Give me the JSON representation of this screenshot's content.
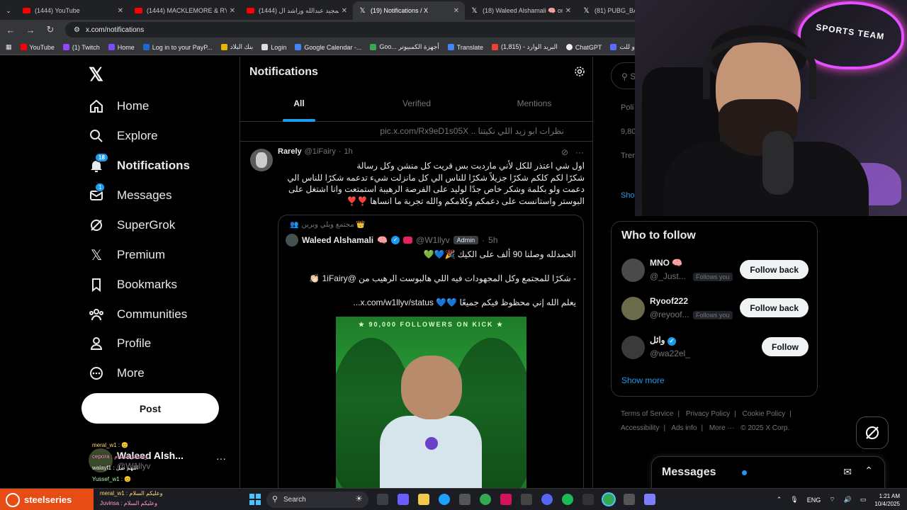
{
  "browser": {
    "tabs": [
      {
        "title": "(1444) YouTube",
        "icon": "youtube-icon",
        "active": false
      },
      {
        "title": "(1444) MACKLEMORE & RY",
        "icon": "youtube-icon",
        "active": false
      },
      {
        "title": "(1444) عبدالمجيد عبدالله وراشد ال",
        "icon": "youtube-icon",
        "active": false
      },
      {
        "title": "(19) Notifications / X",
        "icon": "x-icon",
        "active": true
      },
      {
        "title": "(18) Waleed Alshamali 🧠 on X",
        "icon": "x-icon",
        "active": false
      },
      {
        "title": "(81) PUBG_BAT",
        "icon": "x-icon",
        "active": false
      }
    ],
    "url": "x.com/notifications",
    "bookmarks": [
      "YouTube",
      "(1) Twitch",
      "Home",
      "Log in to your PayP...",
      "بنك البلاد",
      "Login",
      "Google Calendar -...",
      "Goo... أجهزة الكمبيوتر",
      "Translate",
      "البريد الوارد - (1,815)",
      "ChatGPT",
      "وزارة وواو للت..."
    ]
  },
  "leftnav": {
    "items": [
      {
        "label": "Home",
        "icon": "home-icon",
        "bold": false
      },
      {
        "label": "Explore",
        "icon": "search-icon",
        "bold": false
      },
      {
        "label": "Notifications",
        "icon": "bell-icon",
        "bold": true,
        "badge": "18"
      },
      {
        "label": "Messages",
        "icon": "envelope-icon",
        "bold": false,
        "badge": "1"
      },
      {
        "label": "SuperGrok",
        "icon": "grok-icon",
        "bold": false
      },
      {
        "label": "Premium",
        "icon": "x-logo-icon",
        "bold": false
      },
      {
        "label": "Bookmarks",
        "icon": "bookmark-icon",
        "bold": false
      },
      {
        "label": "Communities",
        "icon": "communities-icon",
        "bold": false
      },
      {
        "label": "Profile",
        "icon": "person-icon",
        "bold": false
      },
      {
        "label": "More",
        "icon": "more-circle-icon",
        "bold": false
      }
    ],
    "post_label": "Post",
    "account": {
      "name": "Waleed Alsh...",
      "handle": "@W1llyv"
    }
  },
  "main": {
    "title": "Notifications",
    "tabs": [
      {
        "label": "All",
        "active": true
      },
      {
        "label": "Verified",
        "active": false
      },
      {
        "label": "Mentions",
        "active": false
      }
    ],
    "prev_line": "نظرات ابو زيد اللي نكيتنا .. pic.x.com/Rx9eD1s05X",
    "tweet": {
      "name": "Rarely",
      "handle": "@1iFairy",
      "time": "1h",
      "lines": [
        "اول شي اعتذر للكل لأني ماردبت بس قريت كل منشن وكل رسالة",
        "شكرًا لكم كلكم  شكرًا جزيلاً شكرًا للناس الي كل مانزلت شيء تدعمه شكرًا للناس الي",
        "دعمت ولو بكلمة وشكر خاص جدًا لوليد على الفرصة الرهيبة استمتعت وانا اشتغل على",
        "البوستر واستانست على دعمكم وكلامكم والله تجربة ما انساها ❣️❣️"
      ],
      "quote": {
        "community": "مجتمع وبلي وبرين 👑",
        "name": "Waleed Alshamali",
        "handle": "@W1llyv",
        "role": "Admin",
        "time": "5h",
        "line1": "الحمدلله وصلنا 90 ألف على الكيك 🎉💙💚",
        "line2": "- شكرًا للمجتمع وكل المجهودات فيه اللي هالبوست الرهيب من @1iFairy 👏🏻",
        "line3": "يعلم الله إني محظوظ فيكم جميعًا 💙💙  x.com/w1llyv/status...",
        "image_caption": "★ 90,000 FOLLOWERS ON KICK ★"
      }
    }
  },
  "right": {
    "search_placeholder": "Search",
    "trends_partial": [
      "Poli",
      "9,80",
      "Tren",
      "Sho"
    ],
    "who_to_follow_title": "Who to follow",
    "suggestions": [
      {
        "name": "MNO 🧠",
        "handle": "@_Just...",
        "follows_you": "Follows you",
        "button": "Follow back"
      },
      {
        "name": "Ryoof222",
        "handle": "@reyoof...",
        "follows_you": "Follows you",
        "button": "Follow back"
      },
      {
        "name": "وائل",
        "handle": "@wa22el_",
        "follows_you": "",
        "button": "Follow"
      }
    ],
    "show_more": "Show more",
    "footer": [
      "Terms of Service",
      "Privacy Policy",
      "Cookie Policy",
      "Accessibility",
      "Ads info",
      "More ···",
      "© 2025 X Corp."
    ]
  },
  "messages_dock": {
    "title": "Messages"
  },
  "webcam": {
    "neon_text": "SPORTS TEAM"
  },
  "chat_overlay": [
    "meral_w1 : 😊",
    "cepora : وعليكم السلام",
    "walayf1 : اللهم صل",
    "Yussef_w1 : 😊"
  ],
  "taskbar": {
    "brand": "steelseries",
    "chat": [
      "meral_w1 : وعليكم السلام",
      "Juvinsa : وعليكم السلام"
    ],
    "search_label": "Search",
    "lang": "ENG",
    "time": "1:21 AM",
    "date": "10/4/2025"
  }
}
